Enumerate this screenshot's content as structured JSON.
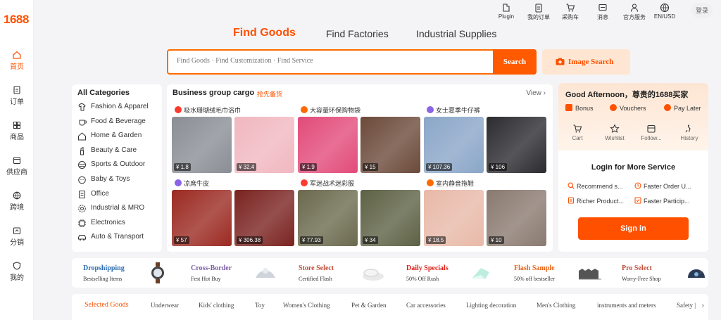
{
  "brand": {
    "logo": "1688",
    "accent": "#ff5000"
  },
  "rail": [
    {
      "label": "首页",
      "icon": "home-icon"
    },
    {
      "label": "订单",
      "icon": "order-icon"
    },
    {
      "label": "商品",
      "icon": "grid-icon"
    },
    {
      "label": "供应商",
      "icon": "store-icon"
    },
    {
      "label": "跨境",
      "icon": "globe-icon"
    },
    {
      "label": "分销",
      "icon": "share-icon"
    },
    {
      "label": "我的",
      "icon": "user-shield-icon"
    }
  ],
  "topbar": {
    "items": [
      {
        "label": "Plugin",
        "icon": "plugin-icon"
      },
      {
        "label": "我的订单",
        "icon": "clipboard-icon"
      },
      {
        "label": "采购车",
        "icon": "cart-icon"
      },
      {
        "label": "消息",
        "icon": "message-icon"
      },
      {
        "label": "官方服务",
        "icon": "person-icon"
      },
      {
        "label": "EN/USD",
        "icon": "globe-icon"
      }
    ],
    "login": "登录"
  },
  "search": {
    "tabs": [
      "Find Goods",
      "Find Factories",
      "Industrial Supplies"
    ],
    "placeholder": "Find Goods · Find Customization · Find Service",
    "button": "Search",
    "image_search": "Image Search"
  },
  "categories": {
    "title": "All Categories",
    "items": [
      {
        "label": "Fashion & Apparel",
        "icon": "shirt-icon"
      },
      {
        "label": "Food & Beverage",
        "icon": "cup-icon"
      },
      {
        "label": "Home & Garden",
        "icon": "house-icon"
      },
      {
        "label": "Beauty & Care",
        "icon": "lipstick-icon"
      },
      {
        "label": "Sports & Outdoor",
        "icon": "sports-icon"
      },
      {
        "label": "Baby & Toys",
        "icon": "baby-icon"
      },
      {
        "label": "Office",
        "icon": "document-icon"
      },
      {
        "label": "Industrial & MRO",
        "icon": "gear-icon"
      },
      {
        "label": "Electronics",
        "icon": "chip-icon"
      },
      {
        "label": "Auto & Transport",
        "icon": "car-icon"
      }
    ]
  },
  "cargo": {
    "title": "Business group cargo",
    "subtitle": "抢先备货",
    "view": "View",
    "groups": [
      {
        "title": "吸水珊瑚绒毛巾浴巾",
        "badge_color": "#ff3b30",
        "prices": [
          "¥ 1.8",
          "¥ 32.4"
        ],
        "img_colors": [
          "#8a8e95",
          "#f1b7c0"
        ]
      },
      {
        "title": "大容量环保购物袋",
        "badge_color": "#ff6a00",
        "prices": [
          "¥ 1.9",
          "¥ 15"
        ],
        "img_colors": [
          "#e24b7a",
          "#6b4a3a"
        ]
      },
      {
        "title": "女士夏季牛仔裤",
        "badge_color": "#8a63e6",
        "prices": [
          "¥ 107.36",
          "¥ 106"
        ],
        "img_colors": [
          "#8aa6c8",
          "#2b2b30"
        ]
      },
      {
        "title": "凉席牛皮",
        "badge_color": "#8a63e6",
        "prices": [
          "¥ 57",
          "¥ 306.38"
        ],
        "img_colors": [
          "#9b2a22",
          "#7a2320"
        ]
      },
      {
        "title": "军迷战术迷彩服",
        "badge_color": "#ff3b30",
        "prices": [
          "¥ 77.93",
          "¥ 34"
        ],
        "img_colors": [
          "#6b6a4e",
          "#5d6144"
        ]
      },
      {
        "title": "室内静音拖鞋",
        "badge_color": "#ff6a00",
        "prices": [
          "¥ 18.5",
          "¥ 10"
        ],
        "img_colors": [
          "#e8b9a8",
          "#8a7a70"
        ]
      }
    ]
  },
  "account": {
    "greeting": "Good Afternoon，尊贵的1688买家",
    "perks": [
      "Bonus",
      "Vouchers",
      "Pay Later"
    ],
    "quick_links": [
      {
        "label": "Cart",
        "icon": "cart-icon"
      },
      {
        "label": "Wishlist",
        "icon": "star-icon"
      },
      {
        "label": "Follow...",
        "icon": "store-icon"
      },
      {
        "label": "History",
        "icon": "history-icon"
      }
    ],
    "login_title": "Login for More Service",
    "services": [
      "Recommend s...",
      "Faster Order U...",
      "Richer Product...",
      "Faster Particip..."
    ],
    "sign_in": "Sign in"
  },
  "promos": [
    {
      "title": "Dropshipping",
      "sub": "Bestselling Items",
      "color": "#2b6cb0"
    },
    {
      "title": "Cross-Border",
      "sub": "Fest Hot Buy",
      "color": "#7b5ea7"
    },
    {
      "title": "Store Select",
      "sub": "Certified Flash",
      "color": "#c0503a"
    },
    {
      "title": "Daily Specials",
      "sub": "50% Off Rush",
      "color": "#e0201a"
    },
    {
      "title": "Flash Sample",
      "sub": "50% off bestseller",
      "color": "#e8651a"
    },
    {
      "title": "Pro Select",
      "sub": "Worry-Free Shop",
      "color": "#c0503a"
    }
  ],
  "category_tabs": [
    "Selected Goods",
    "Underwear",
    "Kids' clothing",
    "Toy",
    "Women's Clothing",
    "Pet & Garden",
    "Car accessories",
    "Lighting decoration",
    "Men's Clothing",
    "instruments and meters",
    "Safety |"
  ]
}
